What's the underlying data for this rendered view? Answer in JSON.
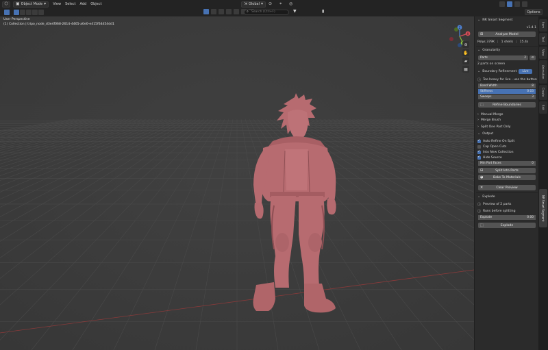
{
  "header": {
    "mode": "Object Mode",
    "menus": [
      "View",
      "Select",
      "Add",
      "Object"
    ],
    "transform_orientation": "Global",
    "search_placeholder": "Search (Ctrl+F)",
    "options": "Options"
  },
  "viewport": {
    "perspective": "User Perspective",
    "collection": "(1) Collection | tripo_node_d3e4f068-2614-4465-a0e0-e415f64454dd1",
    "gizmo_axes": [
      "X",
      "Y",
      "Z"
    ],
    "model_color": "#b76b70"
  },
  "sidebar": {
    "title": "NR Smart Segment",
    "version": "v1.4.1",
    "analyze_button": "Analyze Model",
    "stats": [
      "Polys 379K",
      "1 shells",
      "15.4s"
    ],
    "granularity": {
      "header": "Granularity",
      "preset": "Parts",
      "count": "2",
      "info": "2 parts on screen"
    },
    "boundary": {
      "header": "Boundary Refinement",
      "live_label": "Live",
      "warning": "Too heavy for live - use the button",
      "params": [
        {
          "label": "Band Width",
          "value": "8"
        },
        {
          "label": "Stiffness",
          "value": "0.03"
        },
        {
          "label": "Sweeps",
          "value": "3"
        }
      ],
      "refine_button": "Refine Boundaries"
    },
    "subpanels": [
      "Manual Merge",
      "Merge Brush",
      "Split One Part Only",
      "Output"
    ],
    "output_options": [
      {
        "label": "Auto Refine On Split",
        "checked": true
      },
      {
        "label": "Cap Open Cuts",
        "checked": false
      },
      {
        "label": "Into New Collection",
        "checked": true
      },
      {
        "label": "Hide Source",
        "checked": true
      }
    ],
    "min_part_faces": {
      "label": "Min Part Faces",
      "value": "0"
    },
    "split_button": "Split Into Parts",
    "bake_button": "Bake To Materials",
    "clear_button": "Clear Preview",
    "explode": {
      "header": "Explode",
      "preview": "Preview of 2 parts",
      "note": "Runs before splitting",
      "field_label": "Explode",
      "field_value": "0.00",
      "button": "Explode"
    }
  },
  "tabs": [
    "Item",
    "Tool",
    "View",
    "Animation",
    "Create",
    "Edit",
    "NR Smart Segment"
  ],
  "colors": {
    "accent": "#4772b3",
    "panel": "#2b2b2b",
    "header": "#232323"
  }
}
